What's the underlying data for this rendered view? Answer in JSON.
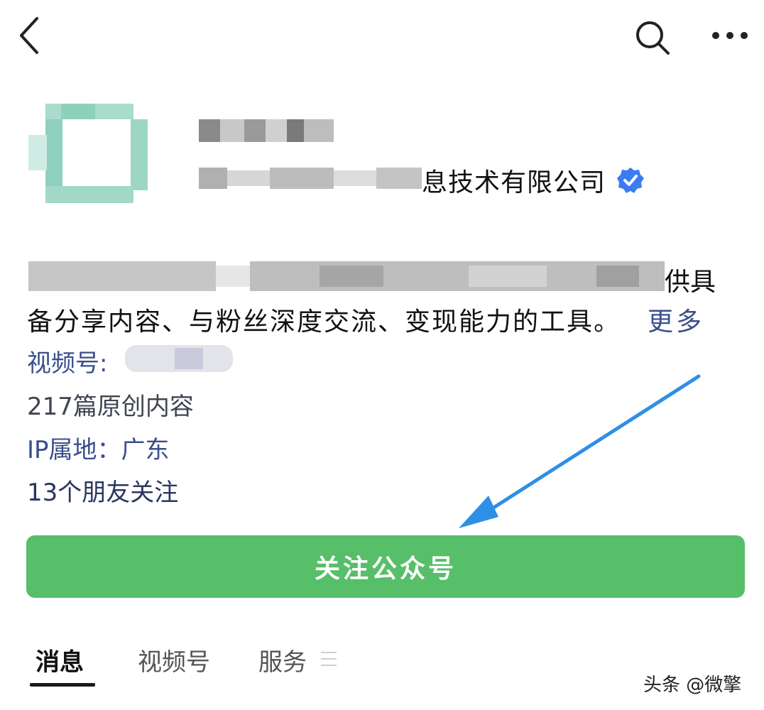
{
  "topbar": {
    "back_icon": "chevron-left-icon",
    "search_icon": "search-icon",
    "more_icon": "more-horizontal-icon"
  },
  "profile": {
    "company_suffix": "息技术有限公司",
    "verified_icon": "verified-badge-icon",
    "verified_color": "#3d7bf0"
  },
  "description": {
    "line1_tail": "供具",
    "line2": "备分享内容、与粉丝深度交流、变现能力的工具。",
    "more_label": "更多"
  },
  "info": {
    "channel_label": "视频号: ",
    "articles": "217篇原创内容",
    "ip": "IP属地：广东",
    "friends": "13个朋友关注"
  },
  "follow_button": {
    "label": "关注公众号",
    "color": "#57be6a"
  },
  "tabs": [
    {
      "label": "消息",
      "active": true
    },
    {
      "label": "视频号",
      "active": false
    },
    {
      "label": "服务",
      "active": false
    }
  ],
  "watermark": "头条 @微擎",
  "annotation": {
    "arrow_color": "#2e8fe6"
  }
}
